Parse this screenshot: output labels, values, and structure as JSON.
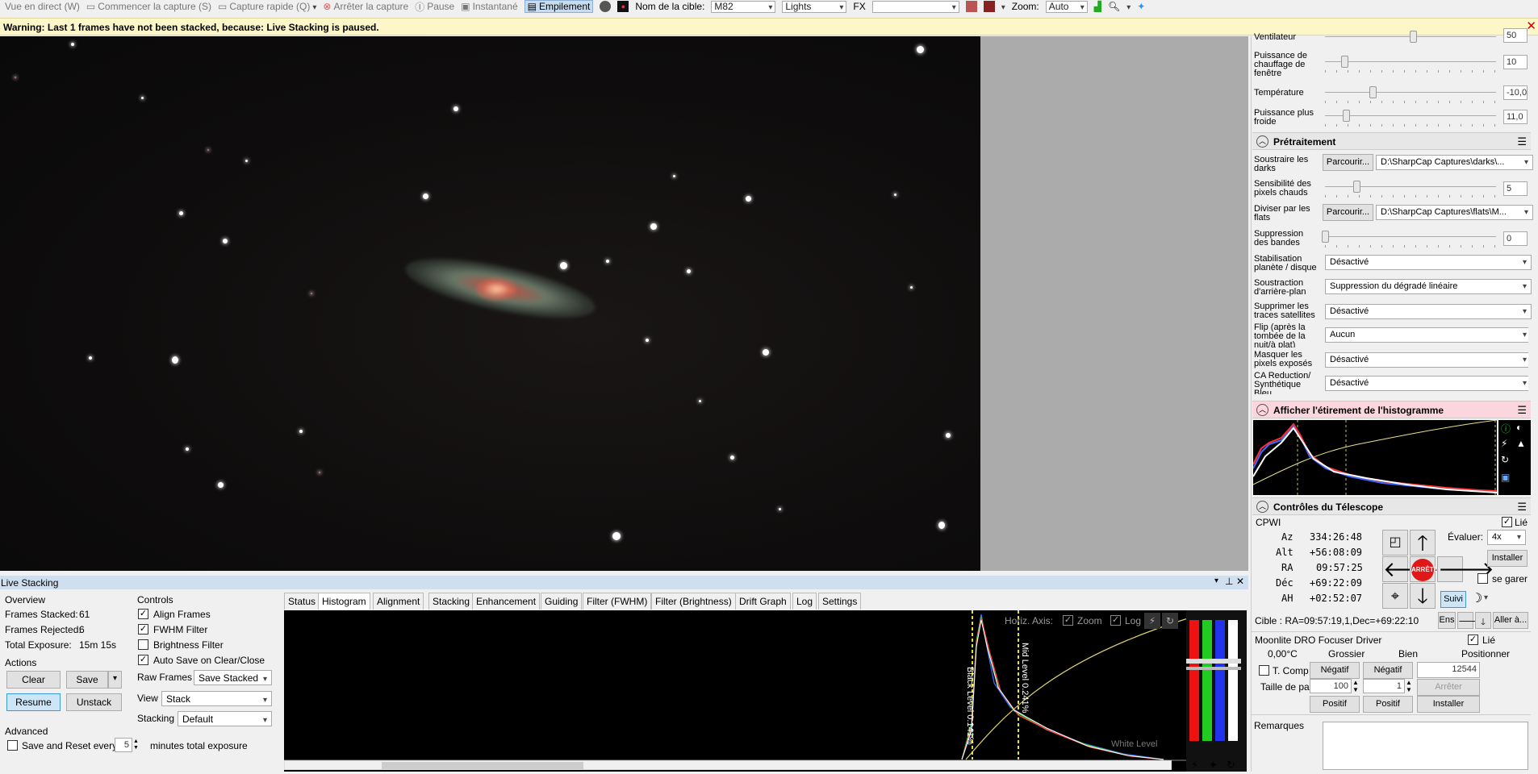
{
  "toolbar": {
    "live_view": "Vue en direct (W)",
    "start_capture": "Commencer la capture (S)",
    "quick_capture": "Capture rapide (Q)",
    "stop_capture": "Arrêter la capture",
    "pause": "Pause",
    "snapshot": "Instantané",
    "stacking": "Empilement",
    "target_label": "Nom de la cible:",
    "target_value": "M82",
    "frame_type": "Lights",
    "fx_label": "FX",
    "fx_value": "",
    "zoom_label": "Zoom:",
    "zoom_value": "Auto"
  },
  "warning": {
    "text": "Warning: Last 1 frames have not been stacked, because: Live Stacking is paused."
  },
  "right_panel": {
    "fan_label": "Ventilateur",
    "fan_value": "50",
    "heat_label": "Puissance de chauffage de fenêtre",
    "heat_value": "10",
    "temp_label": "Température",
    "temp_value": "-10,0",
    "colder_label": "Puissance plus froide",
    "colder_value": "11,0",
    "preprocess_title": "Prétraitement",
    "darks_label": "Soustraire les darks",
    "browse": "Parcourir...",
    "darks_path": "D:\\SharpCap Captures\\darks\\...",
    "hotpix_label": "Sensibilité des pixels chauds",
    "hotpix_value": "5",
    "flats_label": "Diviser par les flats",
    "flats_path": "D:\\SharpCap Captures\\flats\\M...",
    "banding_label": "Suppression des bandes",
    "banding_value": "0",
    "stab_label": "Stabilisation planète / disque",
    "stab_value": "Désactivé",
    "bg_label": "Soustraction d'arrière-plan",
    "bg_value": "Suppression du dégradé linéaire",
    "sat_label": "Supprimer les traces satellites",
    "sat_value": "Désactivé",
    "flip_label": "Flip (après la tombée de la nuit/à plat)",
    "flip_value": "Aucun",
    "mask_label": "Masquer les pixels exposés",
    "mask_value": "Désactivé",
    "ca_label": "CA Reduction/ Synthétique Bleu",
    "ca_value": "Désactivé",
    "histo_title": "Afficher l'étirement de l'histogramme",
    "tele_title": "Contrôles du Télescope",
    "mount_name": "CPWI",
    "linked": "Lié",
    "az_label": "Az",
    "az_value": "334:26:48",
    "alt_label": "Alt",
    "alt_value": "+56:08:09",
    "ra_label": "RA",
    "ra_value": "09:57:25",
    "dec_label": "Déc",
    "dec_value": "+69:22:09",
    "ah_label": "AH",
    "ah_value": "+02:52:07",
    "rate_label": "Évaluer:",
    "rate_value": "4x",
    "install": "Installer",
    "park": "se garer",
    "stop": "ARRÊTE",
    "tracking": "Suivi",
    "target_line": "Cible : RA=09:57:19,1,Dec=+69:22:10",
    "ens": "Ens",
    "goto": "Aller à...",
    "focuser_title": "Moonlite DRO Focuser Driver",
    "focuser_linked": "Lié",
    "temp_reading": "0,00°C",
    "coarse": "Grossier",
    "fine": "Bien",
    "position": "Positionner",
    "tcomp": "T. Comp",
    "negative": "Négatif",
    "position_value": "12544",
    "step_label": "Taille de pas",
    "step_coarse": "100",
    "step_fine": "1",
    "stop_focus": "Arrêter",
    "positive": "Positif",
    "install2": "Installer",
    "notes_label": "Remarques"
  },
  "live_stacking": {
    "title": "Live Stacking",
    "overview": "Overview",
    "frames_stacked_label": "Frames Stacked:",
    "frames_stacked": "61",
    "frames_rejected_label": "Frames Rejected:",
    "frames_rejected": "6",
    "total_exposure_label": "Total Exposure:",
    "total_exposure": "15m 15s",
    "actions": "Actions",
    "clear": "Clear",
    "save": "Save",
    "resume": "Resume",
    "unstack": "Unstack",
    "advanced": "Advanced",
    "save_reset_label": "Save and Reset every",
    "save_reset_value": "5",
    "save_reset_suffix": "minutes total exposure",
    "controls": "Controls",
    "align_frames": "Align Frames",
    "fwhm_filter": "FWHM Filter",
    "brightness_filter": "Brightness Filter",
    "auto_save": "Auto Save on Clear/Close",
    "raw_frames_label": "Raw Frames",
    "raw_frames_value": "Save Stacked",
    "view_label": "View",
    "view_value": "Stack",
    "stacking_label": "Stacking",
    "stacking_value": "Default",
    "tabs": [
      "Status",
      "Histogram",
      "Alignment",
      "Stacking",
      "Enhancement",
      "Guiding",
      "Filter (FWHM)",
      "Filter (Brightness)",
      "Drift Graph",
      "Log",
      "Settings"
    ],
    "horiz_axis": "Horiz. Axis:",
    "zoom": "Zoom",
    "log": "Log",
    "black_level": "Black Level 0.141%",
    "mid_level": "Mid Level 0.241%",
    "white_level": "White Level"
  }
}
